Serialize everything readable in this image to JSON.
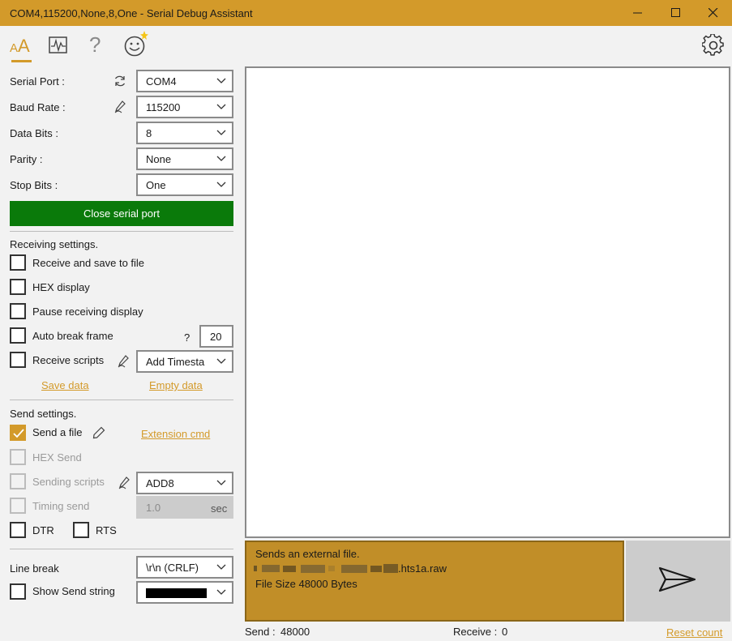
{
  "window": {
    "title": "COM4,115200,None,8,One - Serial Debug Assistant",
    "minimize_icon": "minimize-icon",
    "maximize_icon": "maximize-icon",
    "close_icon": "close-icon"
  },
  "toolbar": {
    "tabs": [
      {
        "icon": "font-aa-icon",
        "active": true
      },
      {
        "icon": "chart-icon",
        "active": false
      },
      {
        "icon": "help-icon",
        "active": false
      },
      {
        "icon": "smiley-new-icon",
        "active": false
      }
    ],
    "settings_icon": "gear-icon"
  },
  "serial": {
    "port_label": "Serial Port :",
    "port_value": "COM4",
    "baud_label": "Baud Rate :",
    "baud_value": "115200",
    "databits_label": "Data Bits :",
    "databits_value": "8",
    "parity_label": "Parity :",
    "parity_value": "None",
    "stopbits_label": "Stop Bits :",
    "stopbits_value": "One",
    "close_button": "Close serial port"
  },
  "receiving": {
    "header": "Receiving settings.",
    "save_to_file": "Receive and save to file",
    "hex_display": "HEX display",
    "pause_display": "Pause receiving display",
    "auto_break": "Auto break frame",
    "auto_break_help": "?",
    "auto_break_value": "20",
    "receive_scripts": "Receive scripts",
    "receive_scripts_value": "Add Timesta",
    "save_data": "Save data",
    "empty_data": "Empty data"
  },
  "sending": {
    "header": "Send settings.",
    "send_file": "Send a file",
    "send_file_checked": true,
    "extension_cmd": "Extension cmd",
    "hex_send": "HEX Send",
    "sending_scripts": "Sending scripts",
    "sending_scripts_value": "ADD8",
    "timing_send": "Timing send",
    "timing_value": "1.0",
    "timing_unit": "sec",
    "dtr": "DTR",
    "rts": "RTS",
    "line_break_label": "Line break",
    "line_break_value": "\\r\\n (CRLF)",
    "show_send_string": "Show Send string"
  },
  "send_box": {
    "line1": "Sends an external file.",
    "file_name_suffix": ".hts1a.raw",
    "line3": "File Size 48000 Bytes"
  },
  "status": {
    "send_label": "Send :",
    "send_count": "48000",
    "receive_label": "Receive :",
    "receive_count": "0",
    "reset_count": "Reset count"
  },
  "colors": {
    "accent": "#d39a2a",
    "close_port_button": "#0a7a0a",
    "send_box": "#c18e28"
  }
}
